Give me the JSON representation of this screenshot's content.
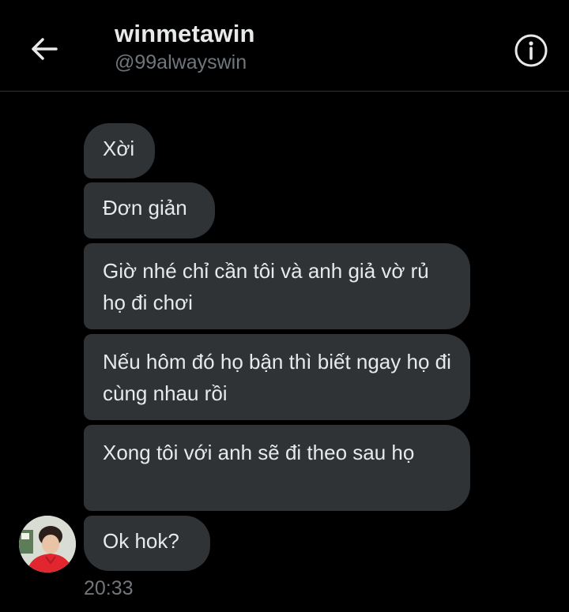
{
  "header": {
    "name": "winmetawin",
    "handle": "@99alwayswin",
    "back_icon": "arrow-left-icon",
    "info_icon": "info-circle-icon"
  },
  "colors": {
    "background": "#000000",
    "bubble": "#2f3336",
    "text": "#e7e9ea",
    "muted": "#71767b"
  },
  "messages": [
    {
      "text": "Xời"
    },
    {
      "text": "Đơn giản"
    },
    {
      "text": "Giờ nhé chỉ cần tôi và anh giả vờ rủ họ đi chơi"
    },
    {
      "text": "Nếu hôm đó họ bận thì biết ngay họ đi cùng nhau rồi"
    },
    {
      "text": "Xong tôi với anh sẽ đi theo sau họ"
    },
    {
      "text": "Ok hok?"
    }
  ],
  "timestamp": "20:33"
}
